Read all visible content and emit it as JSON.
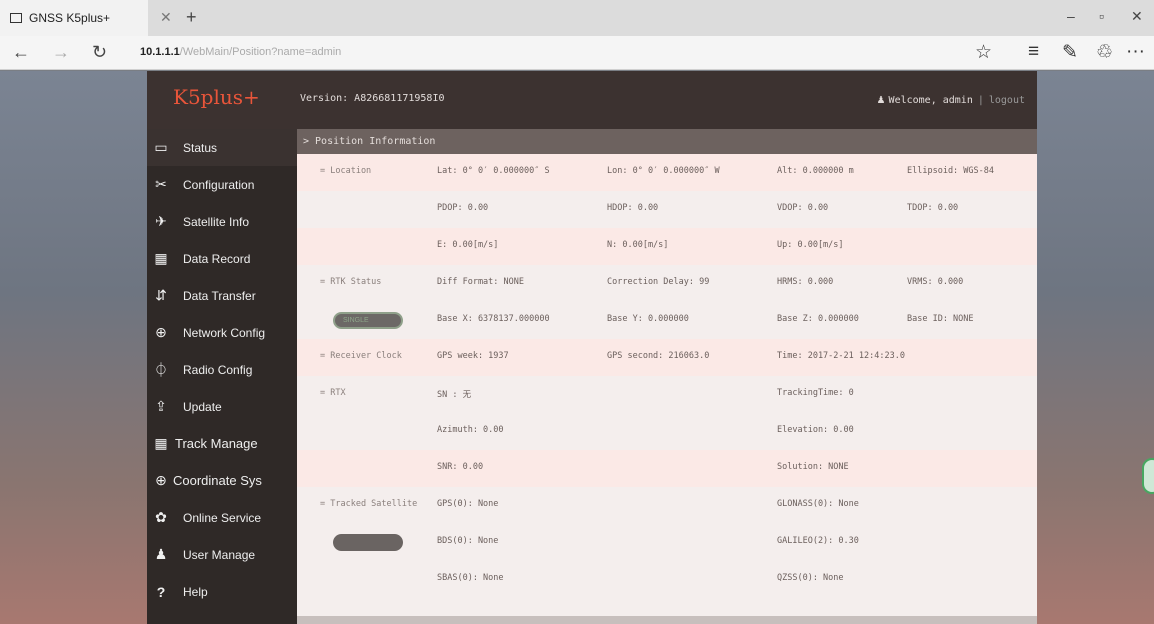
{
  "browser": {
    "tab_title": "GNSS K5plus+",
    "tab_close": "✕",
    "tab_new": "+",
    "url_host": "10.1.1.1",
    "url_rest": "/WebMain/Position?name=admin",
    "buttons": {
      "back": "←",
      "forward": "→",
      "refresh": "↻",
      "favorite": "☆",
      "hub": "≡",
      "note": "✎",
      "share": "♲",
      "more": "···",
      "minimize": "–",
      "maximize": "▫",
      "close": "✕"
    }
  },
  "header": {
    "logo": "K5plus+",
    "version": "Version: A826681171958I0",
    "welcome": "Welcome, admin",
    "logout": "logout"
  },
  "sidebar": {
    "items": [
      {
        "label": "Status",
        "icon": "monitor-icon",
        "glyph": "▭"
      },
      {
        "label": "Configuration",
        "icon": "tools-icon",
        "glyph": "✂"
      },
      {
        "label": "Satellite Info",
        "icon": "satellite-icon",
        "glyph": "✈"
      },
      {
        "label": "Data Record",
        "icon": "calendar-icon",
        "glyph": "▦"
      },
      {
        "label": "Data Transfer",
        "icon": "transfer-icon",
        "glyph": "⇵"
      },
      {
        "label": "Network Config",
        "icon": "globe-icon",
        "glyph": "⊕"
      },
      {
        "label": "Radio Config",
        "icon": "radio-icon",
        "glyph": "⏀"
      },
      {
        "label": "Update",
        "icon": "upload-icon",
        "glyph": "⇪"
      },
      {
        "label": "Track Manage",
        "icon": "track-icon",
        "glyph": "▦"
      },
      {
        "label": "Coordinate Sys",
        "icon": "globe-icon",
        "glyph": "⊕"
      },
      {
        "label": "Online Service",
        "icon": "service-icon",
        "glyph": "✿"
      },
      {
        "label": "User Manage",
        "icon": "users-icon",
        "glyph": "♟"
      },
      {
        "label": "Help",
        "icon": "help-icon",
        "glyph": "?"
      }
    ]
  },
  "panel": {
    "title": "> Position Information",
    "location": {
      "label": "= Location",
      "lat": "Lat: 0° 0′ 0.000000″ S",
      "lon": "Lon: 0° 0′ 0.000000″ W",
      "alt": "Alt: 0.000000 m",
      "ellipsoid": "Ellipsoid: WGS-84",
      "pdop": "PDOP: 0.00",
      "hdop": "HDOP: 0.00",
      "vdop": "VDOP: 0.00",
      "tdop": "TDOP: 0.00",
      "e": "E: 0.00[m/s]",
      "n": "N: 0.00[m/s]",
      "up": "Up: 0.00[m/s]"
    },
    "rtk": {
      "label": "= RTK Status",
      "diff": "Diff Format: NONE",
      "delay": "Correction Delay: 99",
      "hrms": "HRMS: 0.000",
      "vrms": "VRMS: 0.000",
      "pill": "SINGLE",
      "base_x": "Base X: 6378137.000000",
      "base_y": "Base Y: 0.000000",
      "base_z": "Base Z: 0.000000",
      "base_id": "Base ID: NONE"
    },
    "clock": {
      "label": "= Receiver Clock",
      "gps_week": "GPS week: 1937",
      "gps_second": "GPS second: 216063.0",
      "time": "Time: 2017-2-21 12:4:23.0"
    },
    "rtx": {
      "label": "= RTX",
      "sn": "SN : 无",
      "tracking": "TrackingTime: 0",
      "azimuth": "Azimuth: 0.00",
      "elevation": "Elevation: 0.00",
      "snr": "SNR: 0.00",
      "solution": "Solution: NONE"
    },
    "tracked": {
      "label": "= Tracked Satellite",
      "gps": "GPS(0): None",
      "glonass": "GLONASS(0): None",
      "bds": "BDS(0): None",
      "galileo": "GALILEO(2): 0.30",
      "sbas": "SBAS(0): None",
      "qzss": "QZSS(0): None"
    }
  }
}
